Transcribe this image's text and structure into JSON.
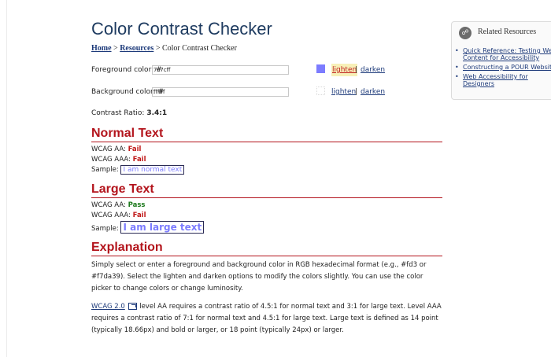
{
  "page": {
    "title": "Color Contrast Checker",
    "breadcrumb": {
      "home": "Home",
      "sep1": ">",
      "resources": "Resources",
      "sep2": ">",
      "current": "Color Contrast Checker"
    }
  },
  "foreground": {
    "label": "Foreground color: #",
    "value": "7c7cff",
    "swatch_color": "#7c7cff",
    "lighten": "lighten",
    "sep": "|",
    "darken": "darken"
  },
  "background": {
    "label": "Background color: #",
    "value": "ffffff",
    "swatch_color": "#ffffff",
    "lighten": "lighten",
    "sep": "|",
    "darken": "darken"
  },
  "contrast": {
    "label": "Contrast Ratio:",
    "value": "3.4:1"
  },
  "normal_text": {
    "heading": "Normal Text",
    "aa_label": "WCAG AA:",
    "aa_result": "Fail",
    "aaa_label": "WCAG AAA:",
    "aaa_result": "Fail",
    "sample_label": "Sample:",
    "sample": "I am normal text"
  },
  "large_text": {
    "heading": "Large Text",
    "aa_label": "WCAG AA:",
    "aa_result": "Pass",
    "aaa_label": "WCAG AAA:",
    "aaa_result": "Fail",
    "sample_label": "Sample:",
    "sample": "I am large text"
  },
  "explanation": {
    "heading": "Explanation",
    "para1": "Simply select or enter a foreground and background color in RGB hexadecimal format (e.g., #fd3 or #f7da39). Select the lighten and darken options to modify the colors slightly. You can use the color picker to change colors or change luminosity.",
    "wcag_link": "WCAG 2.0",
    "para2": "level AA requires a contrast ratio of 4.5:1 for normal text and 3:1 for large text. Level AAA requires a contrast ratio of 7:1 for normal text and 4.5:1 for large text. Large text is defined as 14 point (typically 18.66px) and bold or larger, or 18 point (typically 24px) or larger."
  },
  "sidebar": {
    "icon": "link-icon",
    "title": "Related Resources",
    "items": [
      "Quick Reference: Testing Web Content for Accessibility",
      "Constructing a POUR Website",
      "Web Accessibility for Designers"
    ]
  }
}
